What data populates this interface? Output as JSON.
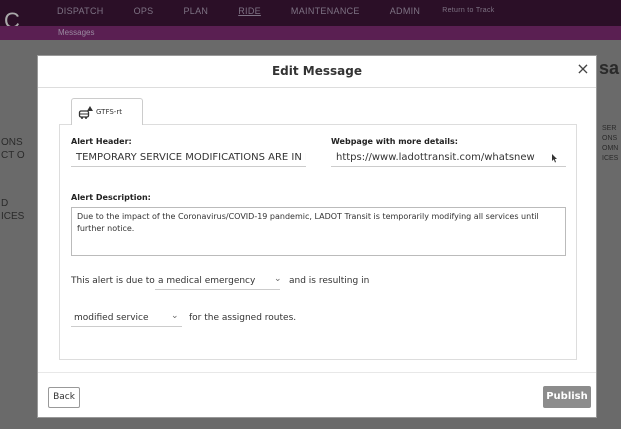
{
  "background": {
    "logo": "C",
    "nav": [
      "DISPATCH",
      "OPS",
      "PLAN",
      "RIDE",
      "MAINTENANCE",
      "ADMIN",
      "Return to Track"
    ],
    "subnav": "Messages",
    "left_fragments": [
      "ONS",
      "CT O",
      "D",
      "ICES"
    ],
    "right_fragments": [
      "sa",
      "SER",
      "ONS",
      "OMN",
      "ICES"
    ]
  },
  "modal": {
    "title": "Edit Message",
    "close": "×",
    "tab_label": "GTFS-rt",
    "alert_header_label": "Alert Header:",
    "alert_header_value": "TEMPORARY SERVICE MODIFICATIONS ARE IN E",
    "webpage_label": "Webpage with more details:",
    "webpage_value": "https://www.ladottransit.com/whatsnew",
    "description_label": "Alert Description:",
    "description_value": "Due to the impact of the Coronavirus/COVID-19 pandemic, LADOT Transit is temporarily modifying all services until further notice.",
    "sentence1_prefix": "This alert is due to",
    "cause_select": "a medical emergency",
    "sentence1_suffix": "and is resulting in",
    "effect_select": "modified service",
    "sentence2_suffix": "for the assigned routes.",
    "back_button": "Back",
    "publish_button": "Publish"
  },
  "colors": {
    "nav_bg": "#2b0f27",
    "subnav_bg": "#5a1f52",
    "publish_bg": "#8c8c8c"
  }
}
